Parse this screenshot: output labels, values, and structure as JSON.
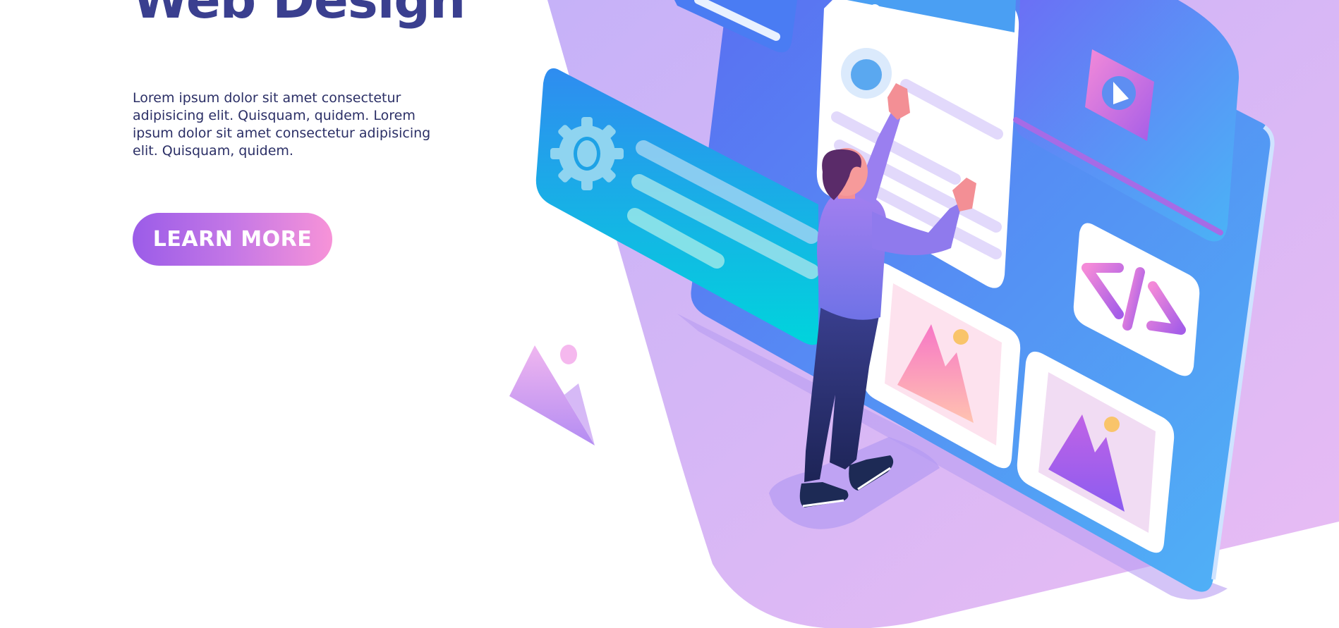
{
  "hero": {
    "title": "Web Design",
    "description": "Lorem ipsum dolor sit amet consectetur adipisicing elit. Quisquam, quidem. Lorem ipsum dolor sit amet consectetur adipisicing elit. Quisquam, quidem.",
    "cta_label": "LEARN MORE"
  },
  "colors": {
    "title": "#3a3f8f",
    "body_text": "#2b2f66",
    "cta_gradient_start": "#9b5ce8",
    "cta_gradient_end": "#f793d8",
    "backdrop": "#c8b3f7",
    "panel_blue": "#4a7cf3",
    "cyan": "#00d0dc"
  },
  "illustration": {
    "icons": [
      "gear-icon",
      "play-icon",
      "code-icon",
      "image-icon",
      "image-icon"
    ],
    "figure": "person-pointing"
  }
}
